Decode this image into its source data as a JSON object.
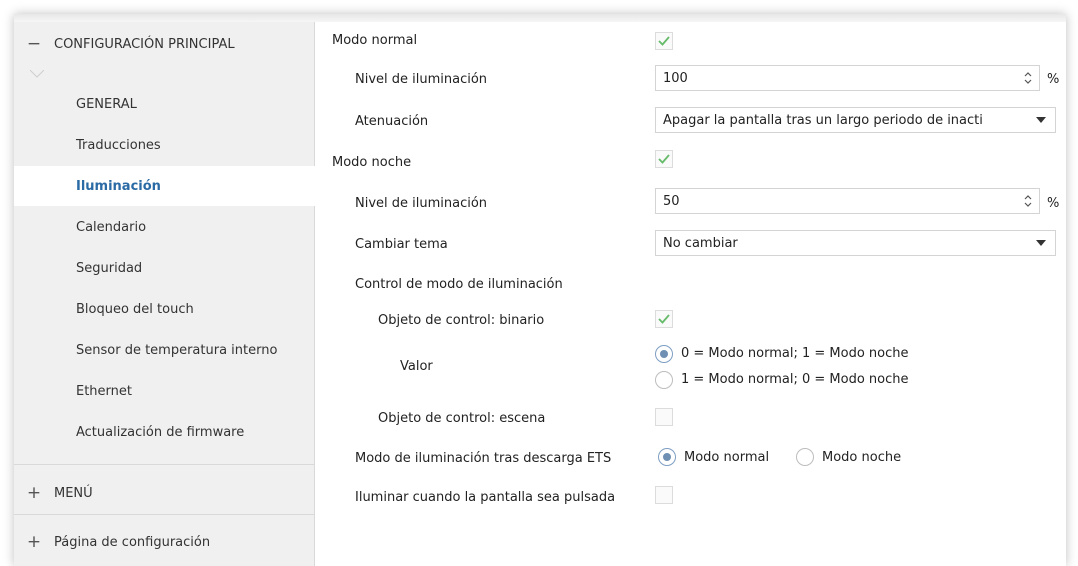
{
  "colors": {
    "accent": "#2a6aa5",
    "check": "#4caf50",
    "sidebar_bg": "#f0f0f0"
  },
  "sidebar": {
    "section_main": {
      "sign": "−",
      "label": "CONFIGURACIÓN PRINCIPAL"
    },
    "items": [
      {
        "label": "GENERAL"
      },
      {
        "label": "Traducciones"
      },
      {
        "label": "Iluminación",
        "active": true
      },
      {
        "label": "Calendario"
      },
      {
        "label": "Seguridad"
      },
      {
        "label": "Bloqueo del touch"
      },
      {
        "label": "Sensor de temperatura interno"
      },
      {
        "label": "Ethernet"
      },
      {
        "label": "Actualización de firmware"
      }
    ],
    "section_menu": {
      "sign": "+",
      "label": "MENÚ"
    },
    "section_config": {
      "sign": "+",
      "label": "Página de configuración"
    }
  },
  "main": {
    "modo_normal": {
      "label": "Modo normal",
      "checked": true
    },
    "nivel_normal": {
      "label": "Nivel de iluminación",
      "value": "100",
      "unit": "%"
    },
    "atenuacion": {
      "label": "Atenuación",
      "value": "Apagar la pantalla tras un largo periodo de inacti"
    },
    "modo_noche": {
      "label": "Modo noche",
      "checked": true
    },
    "nivel_noche": {
      "label": "Nivel de iluminación",
      "value": "50",
      "unit": "%"
    },
    "cambiar_tema": {
      "label": "Cambiar tema",
      "value": "No cambiar"
    },
    "control": {
      "label": "Control de modo de iluminación"
    },
    "obj_binario": {
      "label": "Objeto de control: binario",
      "checked": true
    },
    "valor": {
      "label": "Valor",
      "options": [
        "0 = Modo normal; 1 = Modo noche",
        "1 = Modo normal; 0 = Modo noche"
      ],
      "selected": 0
    },
    "obj_escena": {
      "label": "Objeto de control: escena",
      "checked": false
    },
    "tras_descarga": {
      "label": "Modo de iluminación tras descarga ETS",
      "options": [
        "Modo normal",
        "Modo noche"
      ],
      "selected": 0
    },
    "iluminar_pulsada": {
      "label": "Iluminar cuando la pantalla sea pulsada",
      "checked": false
    }
  }
}
